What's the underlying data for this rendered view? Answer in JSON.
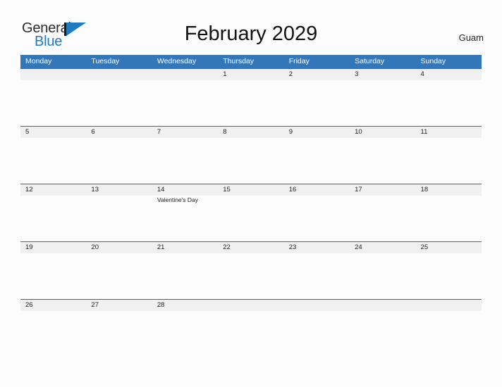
{
  "brand": {
    "word_one": "General",
    "word_two": "Blue",
    "mark": "triangle-flag-icon",
    "colors": {
      "dark": "#2b2b2b",
      "blue": "#1f7ac0"
    }
  },
  "header": {
    "title": "February 2029",
    "location": "Guam"
  },
  "calendar": {
    "colors": {
      "header_band": "#3477b8",
      "row_rule": "#2a6ca8",
      "day_band": "#f0f0f0",
      "page_background": "#fcfcfd"
    },
    "day_headers": [
      "Monday",
      "Tuesday",
      "Wednesday",
      "Thursday",
      "Friday",
      "Saturday",
      "Sunday"
    ],
    "weeks": [
      {
        "days": [
          {
            "num": "",
            "event": ""
          },
          {
            "num": "",
            "event": ""
          },
          {
            "num": "",
            "event": ""
          },
          {
            "num": "1",
            "event": ""
          },
          {
            "num": "2",
            "event": ""
          },
          {
            "num": "3",
            "event": ""
          },
          {
            "num": "4",
            "event": ""
          }
        ]
      },
      {
        "days": [
          {
            "num": "5",
            "event": ""
          },
          {
            "num": "6",
            "event": ""
          },
          {
            "num": "7",
            "event": ""
          },
          {
            "num": "8",
            "event": ""
          },
          {
            "num": "9",
            "event": ""
          },
          {
            "num": "10",
            "event": ""
          },
          {
            "num": "11",
            "event": ""
          }
        ]
      },
      {
        "days": [
          {
            "num": "12",
            "event": ""
          },
          {
            "num": "13",
            "event": ""
          },
          {
            "num": "14",
            "event": "Valentine's Day"
          },
          {
            "num": "15",
            "event": ""
          },
          {
            "num": "16",
            "event": ""
          },
          {
            "num": "17",
            "event": ""
          },
          {
            "num": "18",
            "event": ""
          }
        ]
      },
      {
        "days": [
          {
            "num": "19",
            "event": ""
          },
          {
            "num": "20",
            "event": ""
          },
          {
            "num": "21",
            "event": ""
          },
          {
            "num": "22",
            "event": ""
          },
          {
            "num": "23",
            "event": ""
          },
          {
            "num": "24",
            "event": ""
          },
          {
            "num": "25",
            "event": ""
          }
        ]
      },
      {
        "days": [
          {
            "num": "26",
            "event": ""
          },
          {
            "num": "27",
            "event": ""
          },
          {
            "num": "28",
            "event": ""
          },
          {
            "num": "",
            "event": ""
          },
          {
            "num": "",
            "event": ""
          },
          {
            "num": "",
            "event": ""
          },
          {
            "num": "",
            "event": ""
          }
        ]
      }
    ]
  }
}
